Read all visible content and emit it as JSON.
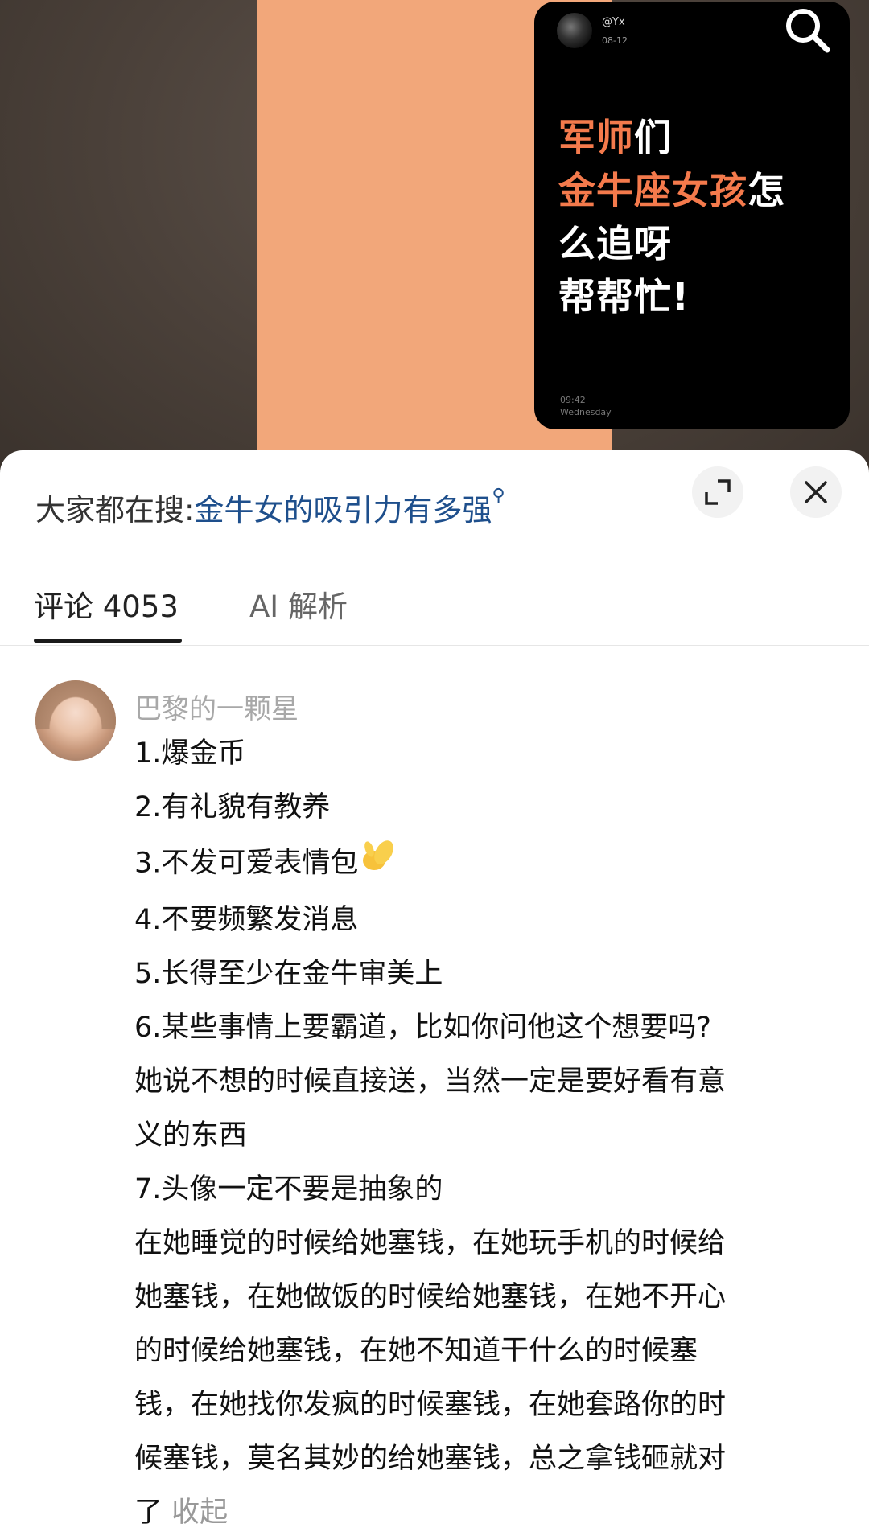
{
  "video": {
    "handle": "@Yx",
    "date": "08-12",
    "headline": {
      "l1_orange": "军师",
      "l1_white": "们",
      "l2_orange": "金牛座女孩",
      "l2_white": "怎",
      "l3": "么追呀",
      "l4": "帮帮忙!"
    },
    "time": "09:42",
    "day": "Wednesday"
  },
  "suggest": {
    "prefix": "大家都在搜:",
    "query": "金牛女的吸引力有多强"
  },
  "tabs": {
    "comments": "评论 4053",
    "ai": "AI 解析"
  },
  "comment": {
    "author": "巴黎的一颗星",
    "lines": [
      "1.爆金币",
      "2.有礼貌有教养",
      "3.不发可爱表情包",
      "4.不要频繁发消息",
      "5.长得至少在金牛审美上",
      "6.某些事情上要霸道，比如你问他这个想要吗?",
      "她说不想的时候直接送，当然一定是要好看有意",
      "义的东西",
      "7.头像一定不要是抽象的",
      "在她睡觉的时候给她塞钱，在她玩手机的时候给",
      "她塞钱，在她做饭的时候给她塞钱，在她不开心",
      "的时候给她塞钱，在她不知道干什么的时候塞",
      "钱，在她找你发疯的时候塞钱，在她套路你的时",
      "候塞钱，莫名其妙的给她塞钱，总之拿钱砸就对"
    ],
    "last_line": "了",
    "collapse": "收起"
  },
  "icons": {
    "search": "search-icon",
    "expand": "expand-icon",
    "close": "close-icon",
    "emoji": "pinched-fingers-emoji"
  },
  "colors": {
    "accent_orange": "#f47a4c",
    "link_blue": "#1e4f8c",
    "poster_bg": "#f2a77a"
  }
}
